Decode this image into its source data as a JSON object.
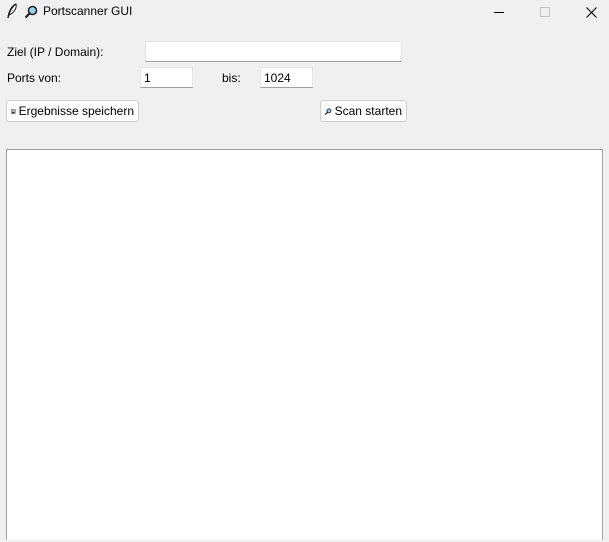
{
  "window": {
    "title": "Portscanner GUI",
    "title_icon": "magnifier-icon",
    "app_icon": "feather-icon"
  },
  "form": {
    "target_label": "Ziel (IP / Domain):",
    "target_value": "",
    "ports_from_label": "Ports von:",
    "ports_from_value": "1",
    "ports_to_label": "bis:",
    "ports_to_value": "1024"
  },
  "buttons": {
    "save_label": "Ergebnisse speichern",
    "save_icon": "floppy-disk-icon",
    "scan_label": "Scan starten",
    "scan_icon": "magnifier-icon"
  },
  "output": {
    "text": ""
  }
}
